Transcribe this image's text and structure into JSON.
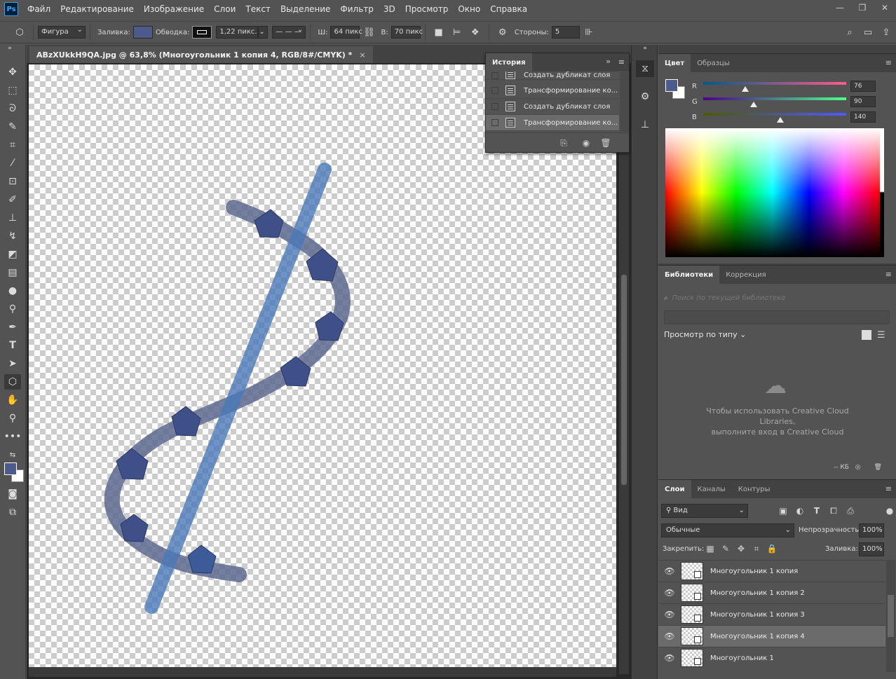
{
  "app": {
    "logo": "Ps"
  },
  "menu": [
    "Файл",
    "Редактирование",
    "Изображение",
    "Слои",
    "Текст",
    "Выделение",
    "Фильтр",
    "3D",
    "Просмотр",
    "Окно",
    "Справка"
  ],
  "options": {
    "mode": "Фигура",
    "fill_label": "Заливка:",
    "stroke_label": "Обводка:",
    "stroke_width": "1,22 пикс.",
    "width_label": "Ш:",
    "width_value": "64 пикс",
    "height_label": "В:",
    "height_value": "70 пикс",
    "sides_label": "Стороны:",
    "sides_value": "5",
    "fill_color": "#4c5a8c"
  },
  "document": {
    "tab_title": "ABzXUkkH9QA.jpg @ 63,8% (Многоугольник 1 копия 4, RGB/8#/CMYK) *",
    "close": "×"
  },
  "history": {
    "title": "История",
    "items": [
      {
        "label": "Создать дубликат слоя",
        "selected": false
      },
      {
        "label": "Трансформирование ко...",
        "selected": false
      },
      {
        "label": "Создать дубликат слоя",
        "selected": false
      },
      {
        "label": "Трансформирование ко...",
        "selected": true
      }
    ]
  },
  "color_panel": {
    "tabs": [
      "Цвет",
      "Образцы"
    ],
    "r": {
      "label": "R",
      "value": "76"
    },
    "g": {
      "label": "G",
      "value": "90"
    },
    "b": {
      "label": "B",
      "value": "140"
    },
    "foreground": "#4c5a8c",
    "background": "#ffffff"
  },
  "libraries": {
    "tabs": [
      "Библиотеки",
      "Коррекция"
    ],
    "search_placeholder": "Поиск по текущей библиотеке",
    "view_by_type": "Просмотр по типу",
    "message_line1": "Чтобы использовать Creative Cloud",
    "message_line2": "Libraries,",
    "message_line3": "выполните вход в Creative Cloud",
    "size": "-- КБ"
  },
  "layers": {
    "tabs": [
      "Слои",
      "Каналы",
      "Контуры"
    ],
    "filter": "Вид",
    "blend_mode": "Обычные",
    "opacity_label": "Непрозрачность:",
    "opacity_value": "100%",
    "lock_label": "Закрепить:",
    "fill_label": "Заливка:",
    "fill_value": "100%",
    "items": [
      {
        "name": "Многоугольник 1 копия",
        "selected": false
      },
      {
        "name": "Многоугольник 1 копия 2",
        "selected": false
      },
      {
        "name": "Многоугольник 1 копия 3",
        "selected": false
      },
      {
        "name": "Многоугольник 1 копия 4",
        "selected": true
      },
      {
        "name": "Многоугольник 1",
        "selected": false
      }
    ]
  }
}
